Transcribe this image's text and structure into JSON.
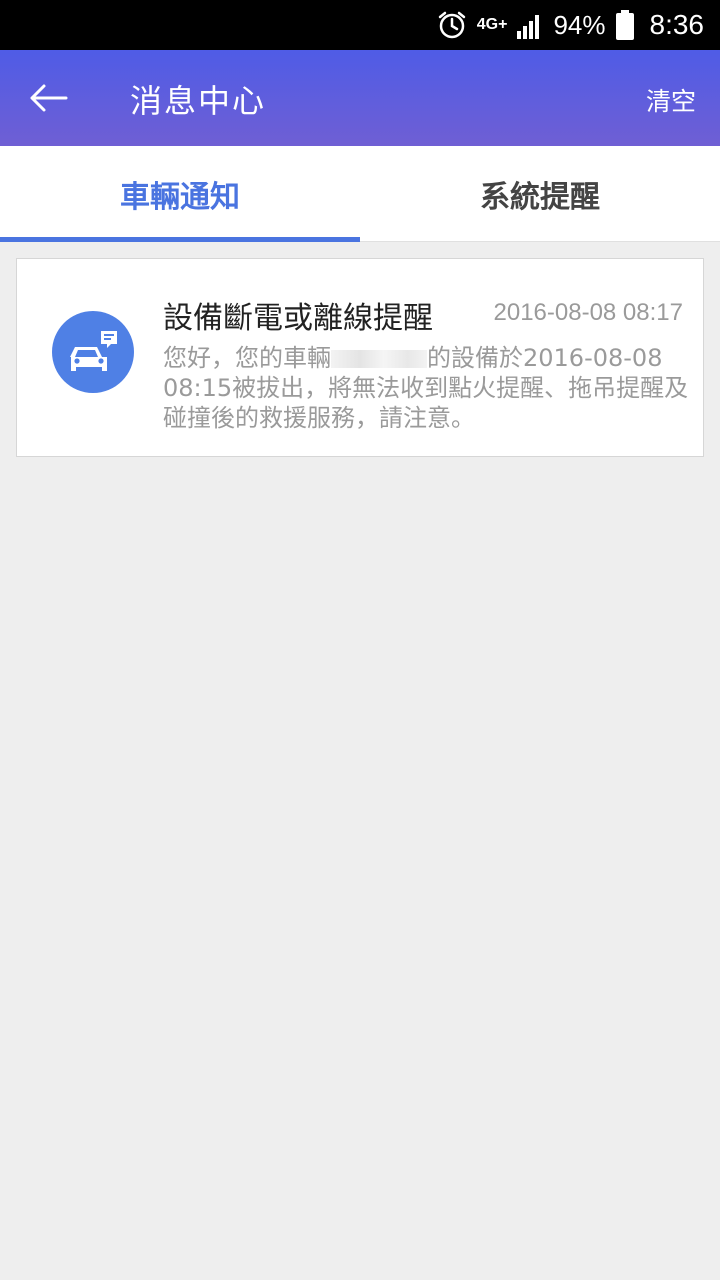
{
  "status_bar": {
    "network": "4G+",
    "battery_percent": "94%",
    "time": "8:36",
    "icons": [
      "alarm-icon",
      "network-4g-icon",
      "signal-icon",
      "battery-icon"
    ]
  },
  "header": {
    "title": "消息中心",
    "back_icon": "arrow-left-icon",
    "clear_label": "清空"
  },
  "tabs": [
    {
      "label": "車輛通知",
      "active": true
    },
    {
      "label": "系統提醒",
      "active": false
    }
  ],
  "notifications": [
    {
      "icon": "car-message-icon",
      "title": "設備斷電或離線提醒",
      "time": "2016-08-08 08:17",
      "body_prefix": "您好，您的車輛",
      "body_suffix": "的設備於2016-08-08 08:15被拔出，將無法收到點火提醒、拖吊提醒及碰撞後的救援服務，請注意。"
    }
  ],
  "colors": {
    "header_gradient_top": "#4f5ce6",
    "header_gradient_bottom": "#6f5fd4",
    "accent": "#4a74e0",
    "avatar": "#4f80e5",
    "background": "#eeeeee"
  }
}
